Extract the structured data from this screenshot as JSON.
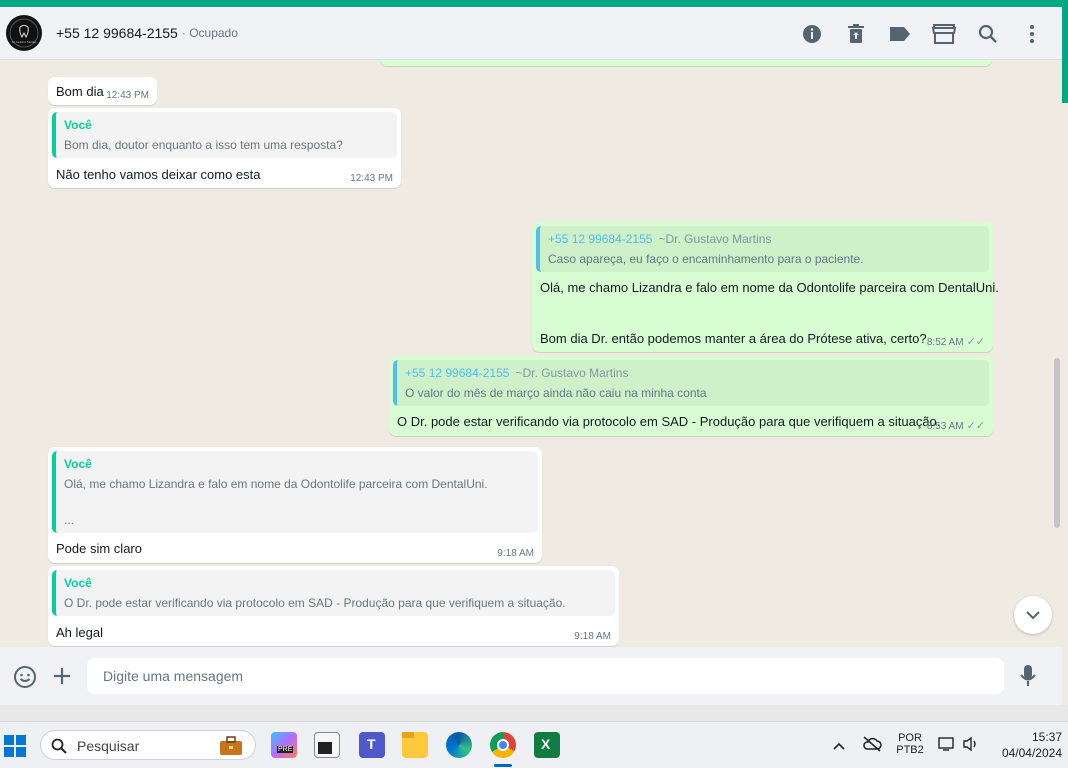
{
  "header": {
    "contact_name": "+55 12 99684-2155",
    "separator": "·",
    "status": "Ocupado",
    "avatar_text": "Dr. Gustavo Martins",
    "icons": [
      "info-icon",
      "delete-icon",
      "label-icon",
      "store-icon",
      "search-icon",
      "more-icon"
    ]
  },
  "messages": [
    {
      "type": "in",
      "text": "Bom dia",
      "time": "12:43 PM"
    },
    {
      "type": "in",
      "quote_author": "Você",
      "quote_text": "Bom dia, doutor enquanto a isso tem uma resposta?",
      "text": "Não tenho vamos deixar como esta",
      "time": "12:43 PM"
    },
    {
      "type": "out",
      "quote_author": "+55 12 99684-2155",
      "quote_sub": "~Dr. Gustavo Martins",
      "quote_text": "Caso apareça, eu faço o encaminhamento para o paciente.",
      "text_line1": "Olá, me chamo Lizandra e falo em nome da Odontolife parceira com DentalUni.",
      "text_line2": "Bom dia Dr. então podemos manter a área do Prótese ativa, certo?",
      "time": "8:52 AM"
    },
    {
      "type": "out",
      "quote_author": "+55 12 99684-2155",
      "quote_sub": "~Dr. Gustavo Martins",
      "quote_text": "O valor do mês de março ainda não caiu na minha conta",
      "text": "O Dr. pode estar verificando via protocolo em SAD - Produção para que verifiquem a situação.",
      "time": "8:53 AM"
    },
    {
      "type": "in",
      "quote_author": "Você",
      "quote_text": "Olá, me chamo Lizandra e falo em nome da Odontolife parceira com DentalUni.",
      "quote_more": "...",
      "text": "Pode sim claro",
      "time": "9:18 AM"
    },
    {
      "type": "in",
      "quote_author": "Você",
      "quote_text": "O Dr. pode estar verificando via protocolo em SAD - Produção para que verifiquem a situação.",
      "text": "Ah legal",
      "time": "9:18 AM"
    }
  ],
  "composer": {
    "placeholder": "Digite uma mensagem"
  },
  "taskbar": {
    "search_label": "Pesquisar",
    "lang_line1": "POR",
    "lang_line2": "PTB2",
    "clock_time": "15:37",
    "clock_date": "04/04/2024",
    "copilot_badge": "PRE"
  },
  "colors": {
    "accent": "#00a884",
    "outgoing": "#d9fdd3",
    "incoming": "#ffffff"
  }
}
